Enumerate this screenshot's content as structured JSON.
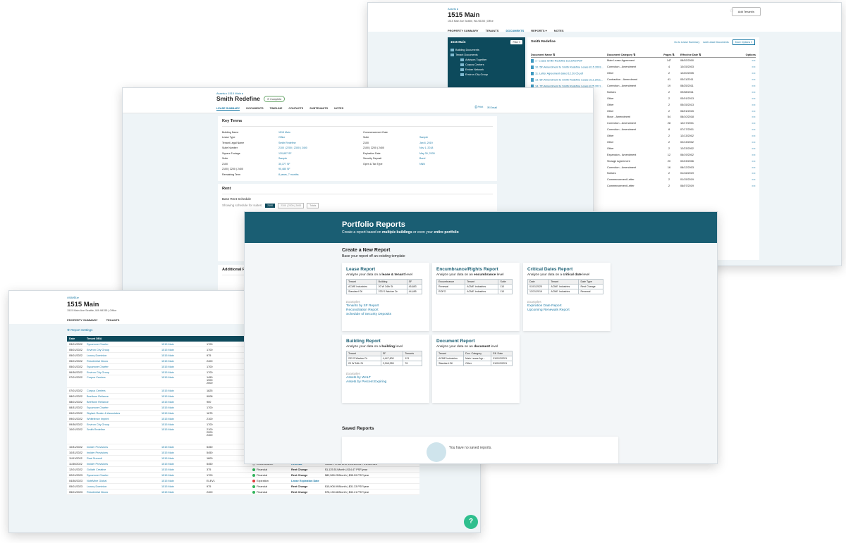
{
  "docs": {
    "crumb": "Assets ▸",
    "title": "1515 Main",
    "address": "1515 Main Ave Seattle, WA 98155  |  Office",
    "add_tenant": "Add Tenant/s",
    "tabs": [
      "PROPERTY SUMMARY",
      "TENANTS",
      "DOCUMENTS",
      "REPORTS ▾",
      "NOTES"
    ],
    "tree_root": "1515 Main",
    "filter": "Filter ▾",
    "tree": [
      "Building Documents",
      "Tenant Documents"
    ],
    "tree_sub": [
      "Advisors Together",
      "Corpus Centers",
      "Ember Network",
      "Environ City Group"
    ],
    "list_title": "Smith Redefine",
    "actions": [
      "Go to Lease Summary",
      "Add Lease Documents",
      "More Options ▾"
    ],
    "cols": [
      "Document Name ⇅",
      "Document Category ⇅",
      "Pages ⇅",
      "Effective Date ⇅",
      "Options"
    ],
    "rows": [
      {
        "name": "1 - Lease Smith Redefine 8.2.2000.PDF",
        "cat": "Main Lease Agreement",
        "pages": "147",
        "date": "08/02/2000"
      },
      {
        "name": "10. 5th Amendment to Smith Redefine Lease 8.15.2003...",
        "cat": "Correction - Amendment",
        "pages": "4",
        "date": "10/15/2003"
      },
      {
        "name": "11. Letter Agreement dated 12.20.05.pdf",
        "cat": "Other",
        "pages": "2",
        "date": "12/20/2005"
      },
      {
        "name": "13. 6th Amendment to Smith Redefine Lease 3.11.2011...",
        "cat": "Contraction - Amendment",
        "pages": "41",
        "date": "03/11/2011"
      },
      {
        "name": "14. 7th Amendment to Smith Redefine Lease 8.25.2011...",
        "cat": "Correction - Amendment",
        "pages": "19",
        "date": "08/25/2011"
      },
      {
        "name": "",
        "cat": "Notices",
        "pages": "2",
        "date": "09/08/2011"
      },
      {
        "name": "",
        "cat": "Other",
        "pages": "2",
        "date": "03/01/2013"
      },
      {
        "name": "",
        "cat": "Other",
        "pages": "2",
        "date": "05/15/2013"
      },
      {
        "name": "",
        "cat": "Other",
        "pages": "2",
        "date": "06/01/2015"
      },
      {
        "name": "",
        "cat": "Move - Amendment",
        "pages": "54",
        "date": "08/10/2018"
      },
      {
        "name": "...t.pdf",
        "cat": "Correction - Amendment",
        "pages": "28",
        "date": "12/17/2001"
      },
      {
        "name": "...27.01.pdf",
        "cat": "Correction - Amendment",
        "pages": "8",
        "date": "07/17/2001"
      },
      {
        "name": "",
        "cat": "Other",
        "pages": "2",
        "date": "12/13/2002"
      },
      {
        "name": "",
        "cat": "Other",
        "pages": "2",
        "date": "02/13/2002"
      },
      {
        "name": "",
        "cat": "Other",
        "pages": "2",
        "date": "12/23/2002"
      },
      {
        "name": "...pdf",
        "cat": "Expansion - Amendment",
        "pages": "12",
        "date": "06/19/2002"
      },
      {
        "name": "",
        "cat": "Storage Agreement",
        "pages": "20",
        "date": "02/23/2006"
      },
      {
        "name": "...",
        "cat": "Correction - Amendment",
        "pages": "16",
        "date": "08/12/2003"
      },
      {
        "name": "...pdf",
        "cat": "Notices",
        "pages": "2",
        "date": "01/16/2019"
      },
      {
        "name": "...ncy Certif...",
        "cat": "Commencement Letter",
        "pages": "2",
        "date": "01/15/2019"
      },
      {
        "name": "...",
        "cat": "Commencement Letter",
        "pages": "2",
        "date": "06/07/2019"
      }
    ]
  },
  "lease": {
    "crumb": "Assets ▸ 1515 Main ▸",
    "title": "Smith Redefine",
    "status": "Complete",
    "tabs": [
      "LEASE SUMMARY",
      "DOCUMENTS",
      "TIMELINE",
      "CONTACTS",
      "SUBTENANTS",
      "NOTES"
    ],
    "print": "Print",
    "email": "Email",
    "key_terms": "Key Terms",
    "left": [
      [
        "Building Name",
        "1515 Main"
      ],
      [
        "Lease Type",
        "Office"
      ],
      [
        "Tenant Legal Name",
        "Smith Redefine"
      ],
      [
        "Suite Number",
        "2100 | 2200 | 2300 | 2400"
      ],
      [
        "Square Footage",
        "120,857 SF"
      ],
      [
        "Suite",
        "Sample"
      ],
      [
        "2100",
        "30,377 SF"
      ],
      [
        "2100 | 2200 | 2400",
        "90,480 SF"
      ],
      [
        "Remaining Term",
        "8 years, 7 months"
      ]
    ],
    "right": [
      [
        "Commencement Date",
        ""
      ],
      [
        "Suite",
        "Sample"
      ],
      [
        "2100",
        "Jan 6, 2019"
      ],
      [
        "2100 | 2200 | 2400",
        "Nov 1, 2018"
      ],
      [
        "Expiration Date",
        "May 30, 2030"
      ],
      [
        "Security Deposit",
        "Bond"
      ],
      [
        "Open & Tax Type",
        "NNN"
      ]
    ],
    "rent": "Rent",
    "rent_sched": "Base Rent Schedule",
    "showing": "Showing schedule for suites:",
    "suite_btns": [
      "2100",
      "2100 | 2200 | 2400",
      "Totals"
    ],
    "additional": "Additional Rent",
    "concessions": "Concessions"
  },
  "dates": {
    "crumb": "Assets ▸",
    "title": "1515 Main",
    "address": "1515 Main Ave Seattle, WA 98155  |  Office",
    "tabs": [
      "PROPERTY SUMMARY",
      "TENANTS"
    ],
    "settings": "Report Settings",
    "header": [
      "Date",
      "Tenant DBA"
    ],
    "rows": [
      {
        "d": "03/01/2022",
        "t": "Sycamore Charter",
        "b": "1515 Main",
        "s": "1700",
        "x": "",
        "k": "",
        "n": "",
        "dot": ""
      },
      {
        "d": "05/01/2022",
        "t": "Environ City Group",
        "b": "1515 Main",
        "s": "1700",
        "x": "",
        "k": "",
        "n": "",
        "dot": ""
      },
      {
        "d": "05/01/2022",
        "t": "Luxury Dominion",
        "b": "1515 Main",
        "s": "975",
        "x": "",
        "k": "",
        "n": "",
        "dot": ""
      },
      {
        "d": "05/01/2022",
        "t": "Residential Neuro",
        "b": "1515 Main",
        "s": "2400",
        "x": "",
        "k": "",
        "n": "",
        "dot": ""
      },
      {
        "d": "05/01/2022",
        "t": "Sycamore Charter",
        "b": "1515 Main",
        "s": "1700",
        "x": "",
        "k": "",
        "n": "",
        "dot": ""
      },
      {
        "d": "06/30/2022",
        "t": "Environ City Group",
        "b": "1515 Main",
        "s": "1700",
        "x": "",
        "k": "",
        "n": "",
        "dot": ""
      },
      {
        "d": "07/01/2022",
        "t": "Corpus Centers",
        "b": "1515 Main",
        "s": "1450\n1900\n2000",
        "x": "",
        "k": "",
        "n": "",
        "dot": "",
        "tall": 3
      },
      {
        "d": "07/01/2022",
        "t": "Corpus Centers",
        "b": "1515 Main",
        "s": "1825",
        "x": "",
        "k": "",
        "n": "",
        "dot": ""
      },
      {
        "d": "08/01/2022",
        "t": "Beeftone Reliance",
        "b": "1515 Main",
        "s": "9008",
        "x": "",
        "k": "",
        "n": "",
        "dot": ""
      },
      {
        "d": "08/01/2022",
        "t": "Beeftone Reliance",
        "b": "1515 Main",
        "s": "900",
        "x": "",
        "k": "",
        "n": "",
        "dot": ""
      },
      {
        "d": "08/31/2022",
        "t": "Sycamore Charter",
        "b": "1515 Main",
        "s": "1700",
        "x": "",
        "k": "",
        "n": "",
        "dot": ""
      },
      {
        "d": "09/01/2022",
        "t": "Skylark Realm & Associates",
        "b": "1515 Main",
        "s": "1675",
        "x": "",
        "k": "",
        "n": "",
        "dot": ""
      },
      {
        "d": "09/01/2022",
        "t": "Whitelence Imprint",
        "b": "1515 Main",
        "s": "2100",
        "x": "",
        "k": "",
        "n": "",
        "dot": ""
      },
      {
        "d": "09/30/2022",
        "t": "Environ City Group",
        "b": "1515 Main",
        "s": "1700",
        "x": "",
        "k": "",
        "n": "",
        "dot": ""
      },
      {
        "d": "10/01/2022",
        "t": "Smith Redefine",
        "b": "1515 Main",
        "s": "2100\n2200\n2400",
        "x": "",
        "k": "",
        "n": "",
        "dot": "",
        "tall": 4
      },
      {
        "d": "10/31/2022",
        "t": "Insider Provisions",
        "b": "1515 Main",
        "s": "5450",
        "x": "Encumbrance",
        "k": "Renewal",
        "n": "Notice Period Start: 10/31/2022 - 01/31/2023",
        "dot": "#cccccc"
      },
      {
        "d": "10/31/2022",
        "t": "Insider Provisions",
        "b": "1515 Main",
        "s": "5450",
        "x": "Financial",
        "k": "Rent Change",
        "n": "$15,389.33/Month | $33.57 PSF/year",
        "dot": "#2fb35a"
      },
      {
        "d": "11/01/2022",
        "t": "Real Summit",
        "b": "1515 Main",
        "s": "1800",
        "x": "Financial",
        "k": "Rent Change",
        "n": "$59,621.07/Month | $39.47 PSF/year",
        "dot": "#2fb35a"
      },
      {
        "d": "11/30/2022",
        "t": "Insider Provisions",
        "b": "1515 Main",
        "s": "5450",
        "x": "Encumbrance",
        "k": "Renewal",
        "n": "Notice Period End: 10/31/2022 - 01/31/2023",
        "dot": "#cccccc"
      },
      {
        "d": "12/01/2022",
        "t": "Goliath Creative",
        "b": "1515 Main",
        "s": "375",
        "x": "Financial",
        "k": "Rent Change",
        "n": "$1,125.51/Month | $14.47 PSF/year",
        "dot": "#2fb35a"
      },
      {
        "d": "02/01/2023",
        "t": "Sycamore Charter",
        "b": "1515 Main",
        "s": "1700",
        "x": "Financial",
        "k": "Rent Change",
        "n": "$82,565.25/Month | $35.59 PSF/year",
        "dot": "#2fb35a"
      },
      {
        "d": "04/30/2023",
        "t": "NoteMine Global",
        "b": "1515 Main",
        "s": "ELEV1",
        "x": "Expiration",
        "k": "Lease Expiration Date",
        "n": "",
        "dot": "#e03a3a"
      },
      {
        "d": "05/01/2023",
        "t": "Luxury Dominion",
        "b": "1515 Main",
        "s": "975",
        "x": "Financial",
        "k": "Rent Change",
        "n": "$15,908.99/Month | $31.33 PSF/year",
        "dot": "#2fb35a"
      },
      {
        "d": "05/01/2023",
        "t": "Residential Neuro",
        "b": "1515 Main",
        "s": "2400",
        "x": "Financial",
        "k": "Rent Change",
        "n": "$78,130.66/Month | $32.21 PSF/year",
        "dot": "#2fb35a"
      }
    ],
    "help": "?"
  },
  "reports": {
    "title": "Portfolio Reports",
    "subtitle_a": "Create a report based on ",
    "subtitle_b": "multiple buildings",
    "subtitle_c": " or even your ",
    "subtitle_d": "entire portfolio",
    "create": "Create a New Report",
    "create_sub": "Base your report off an existing template",
    "examples": "Examples",
    "cards": [
      {
        "title": "Lease Report",
        "desc_a": "Analyze your data on a ",
        "desc_b": "lease & tenant",
        "desc_c": " level",
        "head": [
          "Tenant",
          "Building",
          "SF"
        ],
        "rows": [
          [
            "ACME Industries",
            "20 W 34th St",
            "45,883"
          ],
          [
            "Standard Oil",
            "233 S Wacker Dr",
            "44,485"
          ]
        ],
        "examples": [
          "Tenants by SF Report",
          "Reconciliation Report",
          "Schedule of Security Deposits"
        ]
      },
      {
        "title": "Encumbrance/Rights Report",
        "desc_a": "Analyze your data on an ",
        "desc_b": "encumbrance",
        "desc_c": " level",
        "head": [
          "Encumbrance",
          "Tenant",
          "Suite"
        ],
        "rows": [
          [
            "Renewal",
            "ACME Industries",
            "110"
          ],
          [
            "ROFO",
            "ACME Industries",
            "110"
          ]
        ],
        "examples": []
      },
      {
        "title": "Critical Dates Report",
        "desc_a": "Analyze your data on a ",
        "desc_b": "critical date",
        "desc_c": " level",
        "head": [
          "Date",
          "Tenant",
          "Date Type"
        ],
        "rows": [
          [
            "01/01/2020",
            "ACME Industries",
            "Rent Change"
          ],
          [
            "12/31/2019",
            "ACME Industries",
            "Renewal"
          ]
        ],
        "examples": [
          "Expiration Date Report",
          "Upcoming Renewals Report"
        ]
      },
      {
        "title": "Building Report",
        "desc_a": "Analyze your data on a ",
        "desc_b": "building",
        "desc_c": " level",
        "head": [
          "Tenant",
          "SF",
          "Tenants"
        ],
        "rows": [
          [
            "233 S Wacker Dr",
            "4,447,800",
            "121"
          ],
          [
            "20 W 34th St",
            "2,248,355",
            "76"
          ]
        ],
        "examples": [
          "Assets by WALT",
          "Assets by Percent Expiring"
        ]
      },
      {
        "title": "Document Report",
        "desc_a": "Analyze your data on an ",
        "desc_b": "document",
        "desc_c": " level",
        "head": [
          "Tenant",
          "Doc. Category",
          "Eff. Date"
        ],
        "rows": [
          [
            "ACME Industries",
            "Main Lease Agr...",
            "01/01/20201"
          ],
          [
            "Standard Oil",
            "Other",
            "01/01/20201"
          ]
        ],
        "examples": []
      }
    ],
    "saved": "Saved Reports",
    "no_saved": "You have no saved reports."
  },
  "colors": {
    "teal_dark": "#0d4a5c",
    "banner": "#1a5e73",
    "link": "#1b7aa6",
    "bg": "#eef4f7",
    "help": "#2fbf8e"
  }
}
